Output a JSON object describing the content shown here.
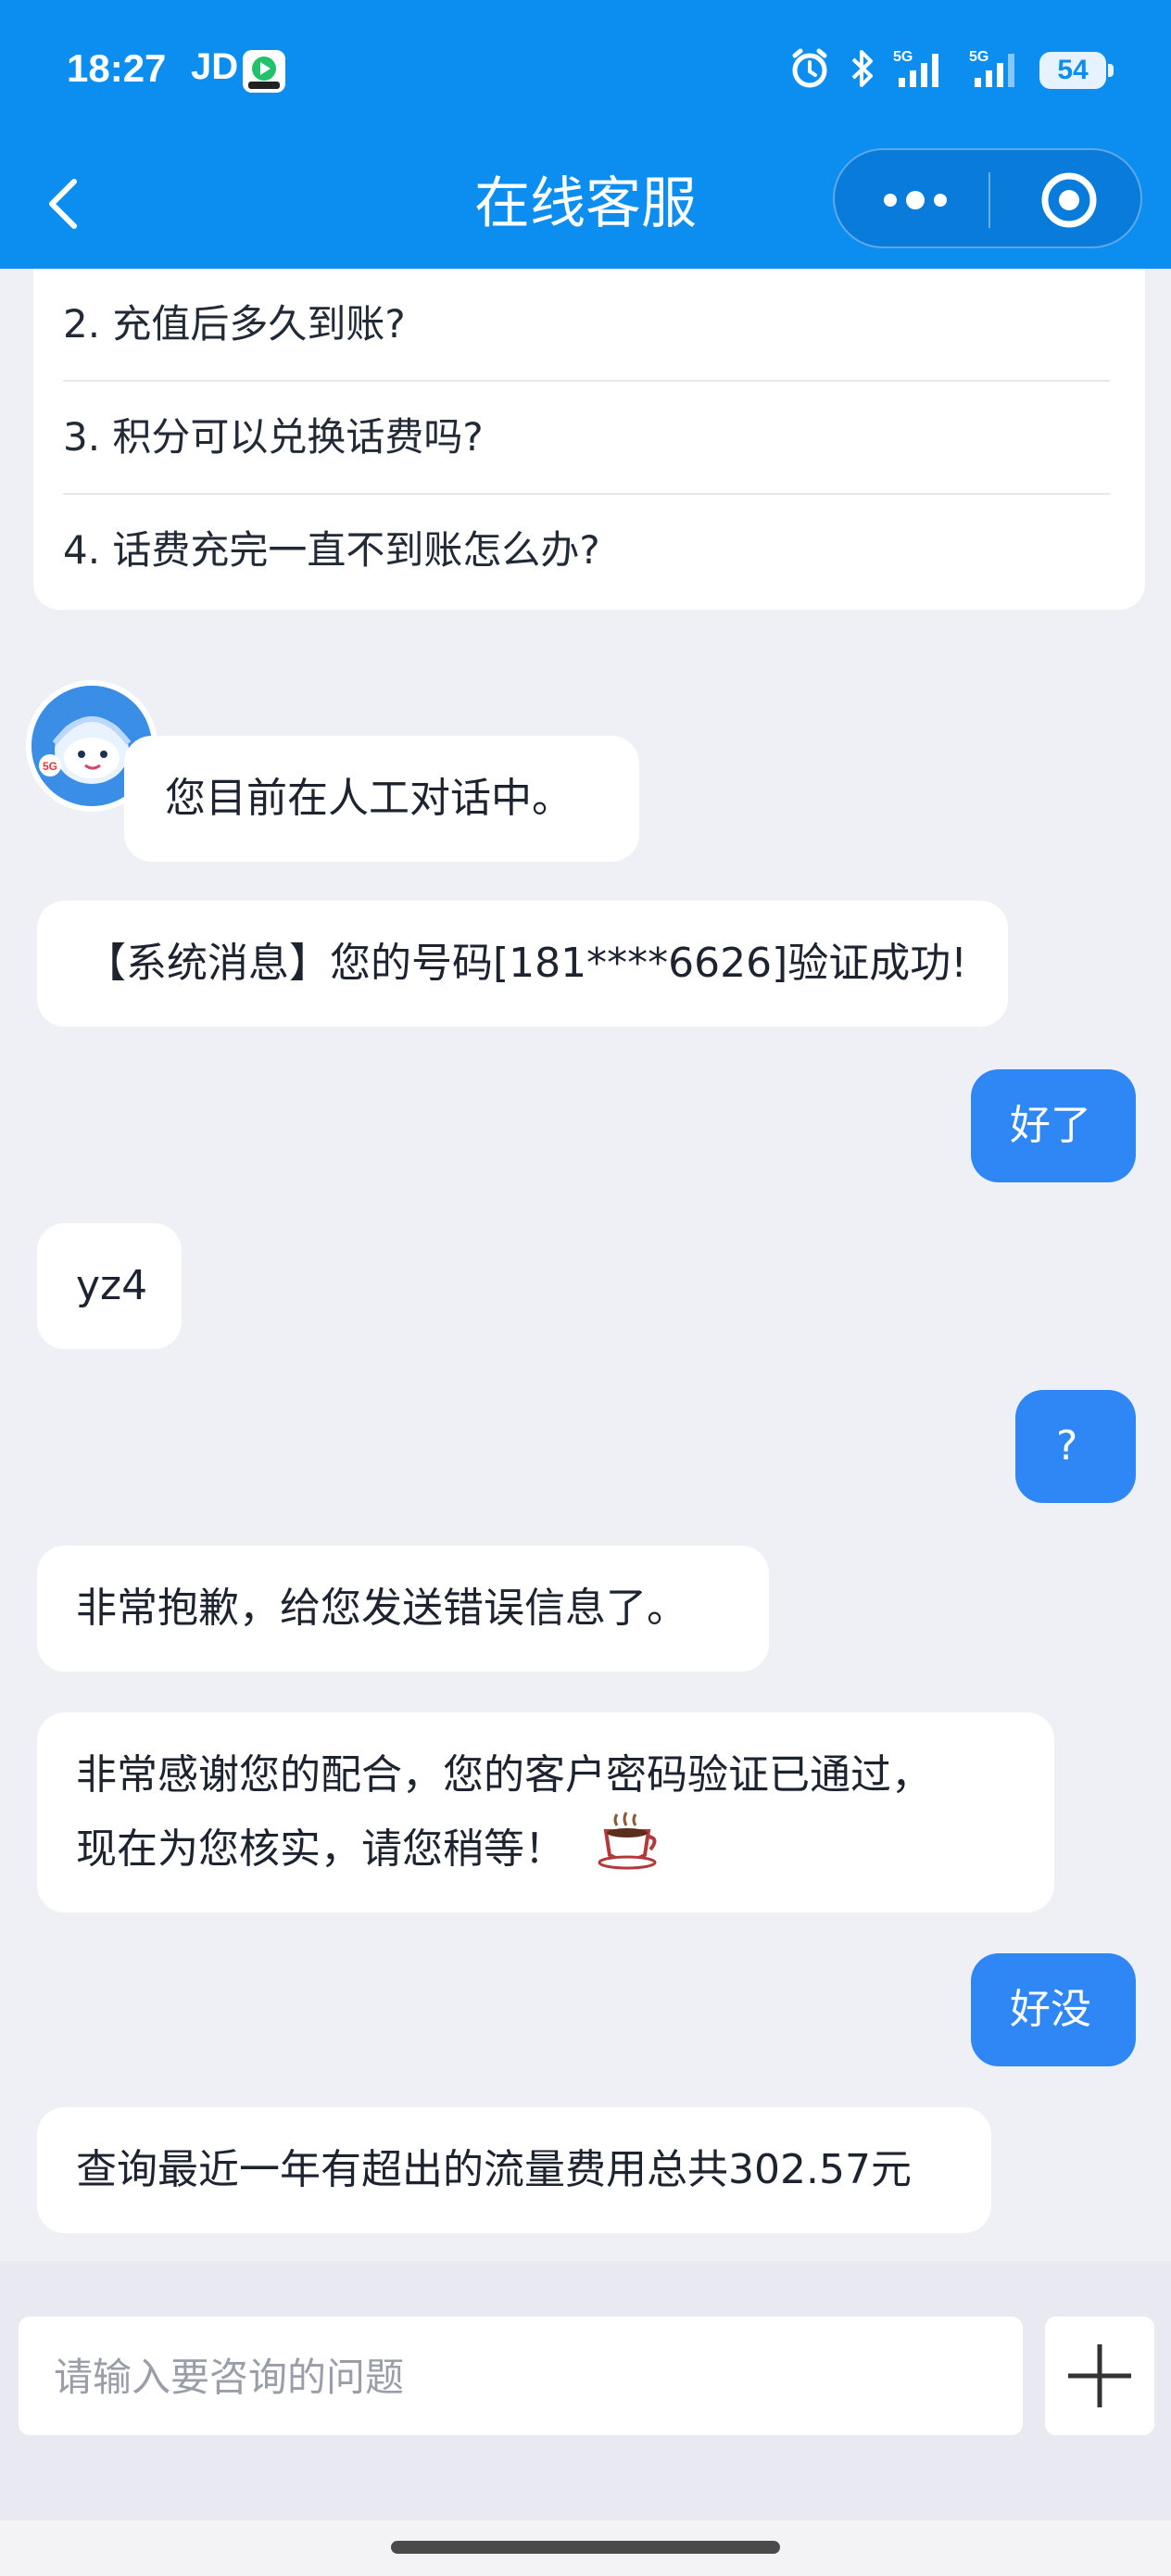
{
  "status_bar": {
    "time": "18:27",
    "carrier": "JD",
    "battery": "54",
    "icons": [
      "app-badge-icon",
      "alarm-icon",
      "bluetooth-icon",
      "signal-5g-icon",
      "signal-5g-icon",
      "battery-icon"
    ]
  },
  "nav": {
    "title": "在线客服",
    "back_icon": "chevron-left-icon",
    "more_icon": "more-dots-icon",
    "close_icon": "target-circle-icon"
  },
  "faq": {
    "items": [
      "2. 充值后多久到账?",
      "3. 积分可以兑换话费吗?",
      "4. 话费充完一直不到账怎么办?"
    ]
  },
  "messages": [
    {
      "from": "agent",
      "text": "您目前在人工对话中。"
    },
    {
      "from": "agent",
      "text": "【系统消息】您的号码[181****6626]验证成功!"
    },
    {
      "from": "user",
      "text": "好了"
    },
    {
      "from": "agent",
      "text": "yz4"
    },
    {
      "from": "user",
      "text": "?"
    },
    {
      "from": "agent",
      "text": "非常抱歉，给您发送错误信息了。"
    },
    {
      "from": "agent",
      "text_line1": "非常感谢您的配合，您的客户密码验证已通过，",
      "text_line2": "现在为您核实，请您稍等！",
      "emoji_icon": "coffee-cup-icon"
    },
    {
      "from": "user",
      "text": "好没"
    },
    {
      "from": "agent",
      "text": "查询最近一年有超出的流量费用总共302.57元"
    }
  ],
  "input": {
    "placeholder": "请输入要咨询的问题",
    "plus_icon": "plus-icon"
  },
  "colors": {
    "header_blue": "#0b8ef0",
    "user_bubble": "#2f86f5",
    "background": "#eef0f6"
  }
}
